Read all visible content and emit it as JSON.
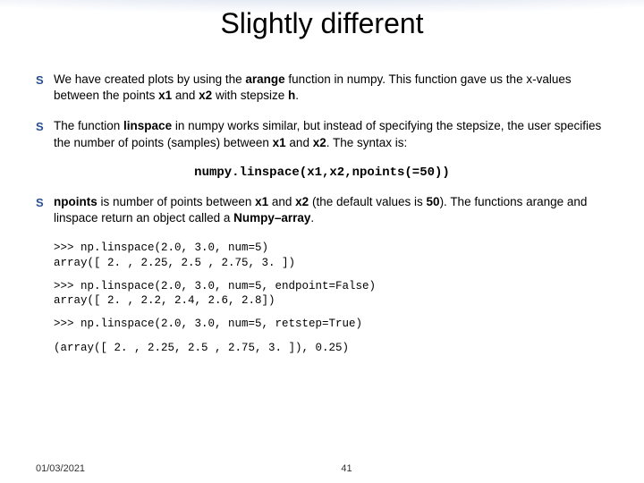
{
  "title": "Slightly different",
  "bullets": {
    "b1_pre": "We have created plots by using the ",
    "b1_bold1": "arange",
    "b1_mid1": " function in numpy. This function gave us the x-values between the points ",
    "b1_bold2": "x1",
    "b1_mid2": " and ",
    "b1_bold3": "x2",
    "b1_mid3": " with stepsize ",
    "b1_bold4": "h",
    "b1_end": ".",
    "b2_pre": "The function ",
    "b2_bold1": "linspace",
    "b2_mid1": " in numpy works similar, but instead of specifying the stepsize, the user specifies the number of points (samples) between ",
    "b2_bold2": "x1",
    "b2_mid2": " and ",
    "b2_bold3": "x2",
    "b2_end": ". The syntax is:",
    "b3_bold1": "npoints",
    "b3_mid1": " is number of points between ",
    "b3_bold2": "x1",
    "b3_mid2": " and ",
    "b3_bold3": "x2",
    "b3_mid3": " (the default values is ",
    "b3_bold4": "50",
    "b3_mid4": "). The functions arange and linspace return an object called a ",
    "b3_bold5": "Numpy–array",
    "b3_end": "."
  },
  "code_syntax": "numpy.linspace(x1,x2,npoints(=50))",
  "examples": {
    "ex1": ">>> np.linspace(2.0, 3.0, num=5)\narray([ 2. , 2.25, 2.5 , 2.75, 3. ])",
    "ex2": ">>> np.linspace(2.0, 3.0, num=5, endpoint=False)\narray([ 2. , 2.2, 2.4, 2.6, 2.8])",
    "ex3": ">>> np.linspace(2.0, 3.0, num=5, retstep=True)",
    "ex4": "(array([ 2. , 2.25, 2.5 , 2.75, 3. ]), 0.25)"
  },
  "footer": {
    "date": "01/03/2021",
    "page": "41"
  },
  "marker": "S"
}
